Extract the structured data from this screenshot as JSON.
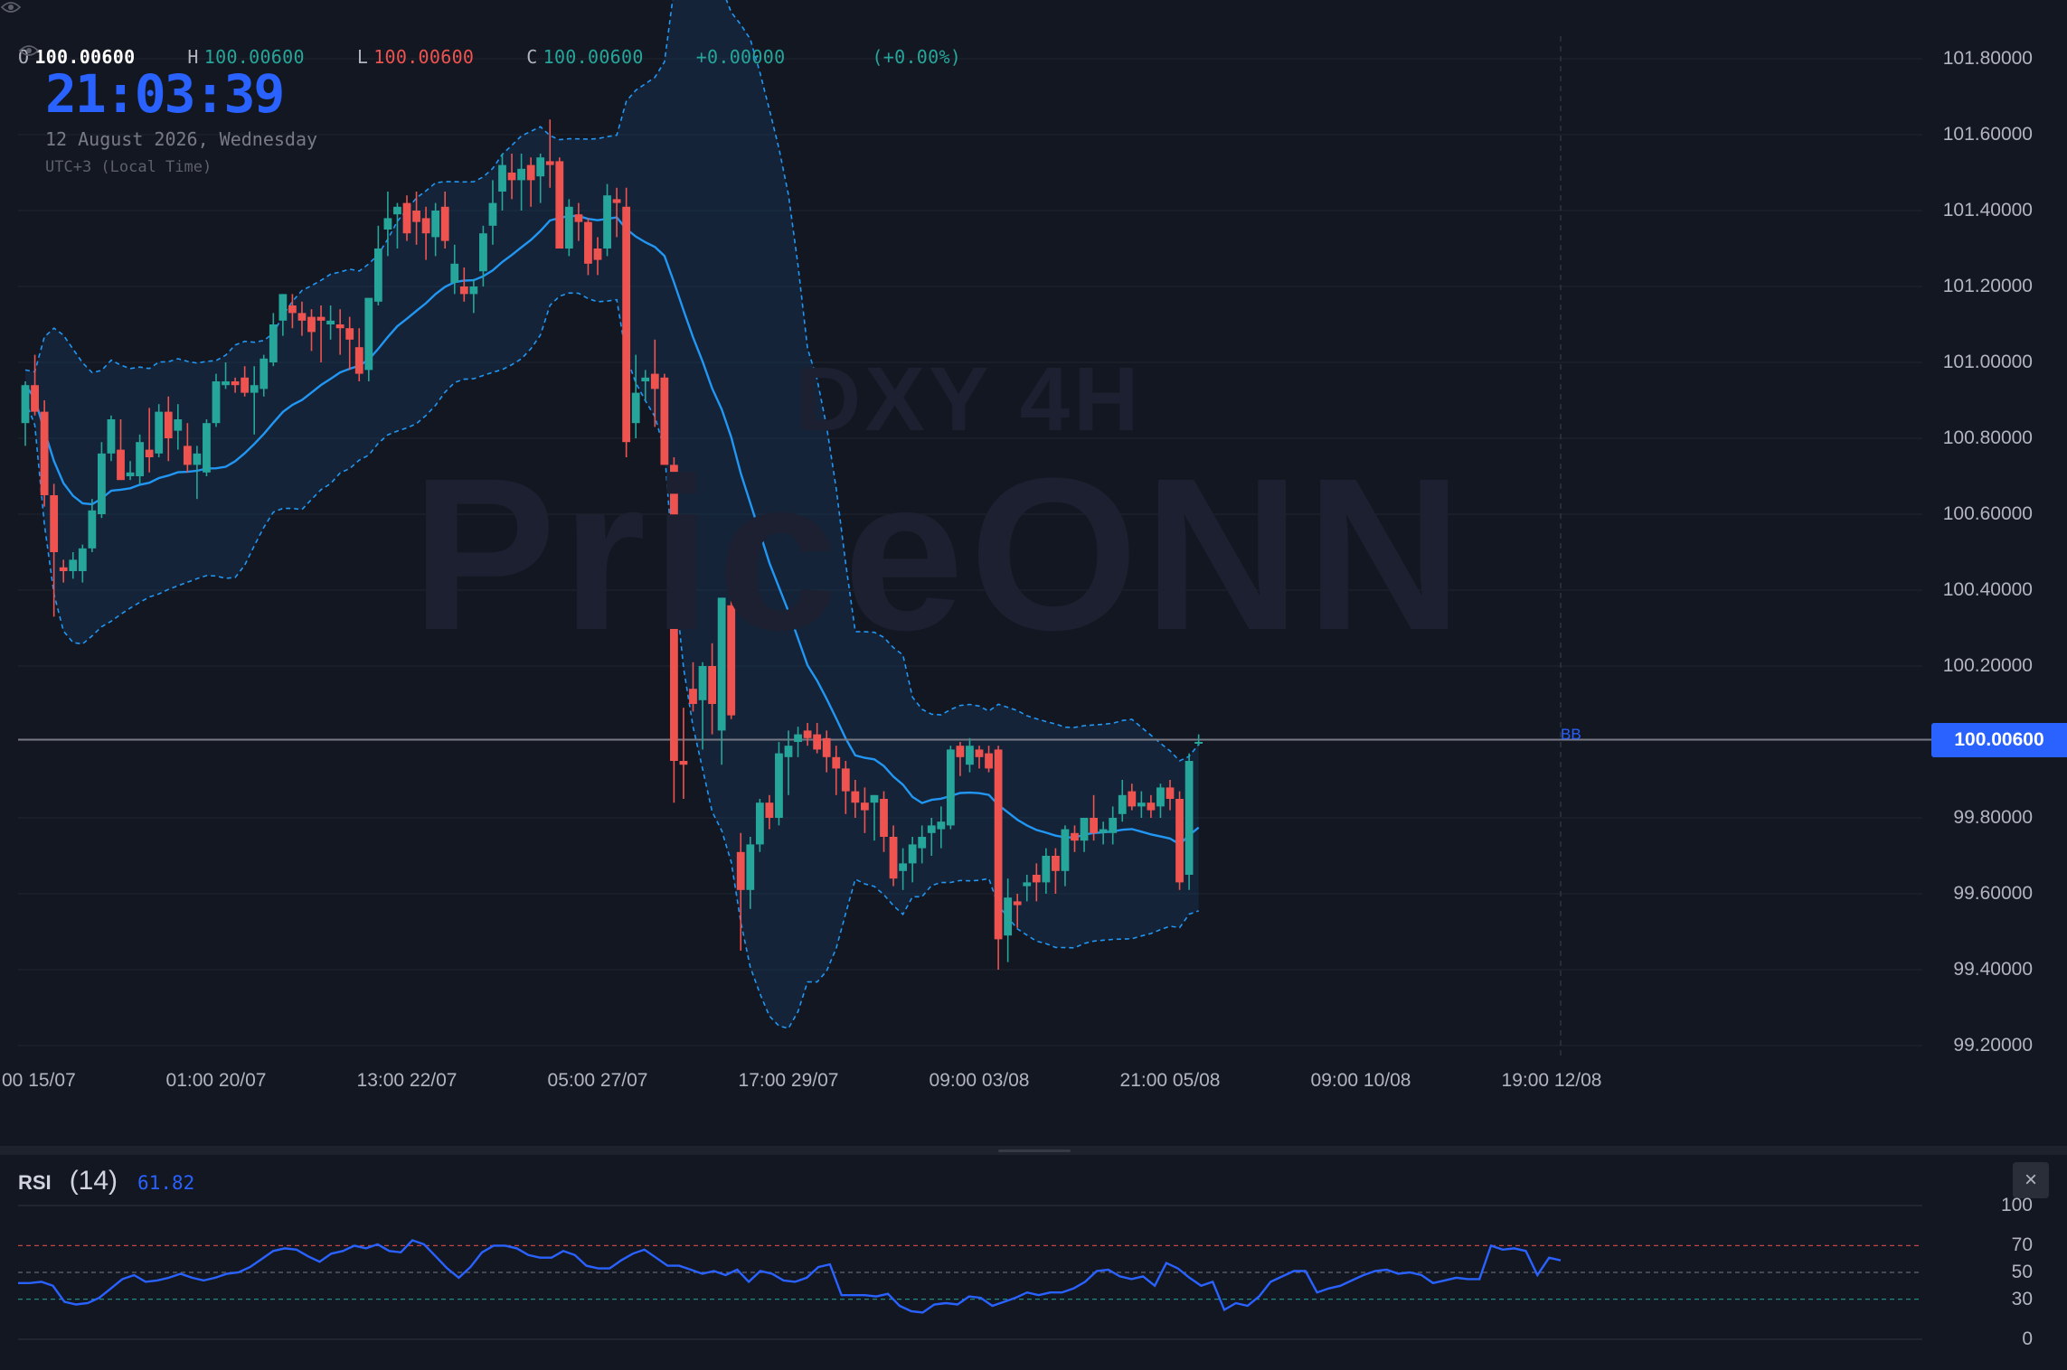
{
  "legend": {
    "o_label": "O",
    "o_value": "100.00600",
    "h_label": "H",
    "h_value": "100.00600",
    "l_label": "L",
    "l_value": "100.00600",
    "c_label": "C",
    "c_value": "100.00600",
    "change": "+0.00000",
    "change_pct": "(+0.00%)"
  },
  "clock": {
    "time": "21:03:39",
    "date": "12 August 2026, Wednesday",
    "timezone": "UTC+3 (Local Time)"
  },
  "watermark": {
    "symbol": "DXY 4H",
    "brand": "PriceONN"
  },
  "current_price": {
    "label": "100.00600",
    "value": 100.006,
    "indicator_tag": "BB"
  },
  "colors": {
    "background": "#131722",
    "up": "#26a69a",
    "down": "#ef5350",
    "accent": "#2962ff",
    "bb_basis": "#2196f3",
    "bb_band": "#2196f3"
  },
  "icons": {
    "visibility": "eye-icon",
    "close": "close-icon"
  },
  "chart_data": {
    "type": "candlestick",
    "y_axis_labels": [
      "101.80000",
      "101.60000",
      "101.40000",
      "101.20000",
      "101.00000",
      "100.80000",
      "100.60000",
      "100.40000",
      "100.20000",
      "99.80000",
      "99.60000",
      "99.40000",
      "99.20000"
    ],
    "y_axis_values": [
      101.8,
      101.6,
      101.4,
      101.2,
      101.0,
      100.8,
      100.6,
      100.4,
      100.2,
      99.8,
      99.6,
      99.4,
      99.2
    ],
    "ylim": [
      99.2,
      101.8
    ],
    "x_axis_labels": [
      "00 15/07",
      "01:00 20/07",
      "13:00 22/07",
      "05:00 27/07",
      "17:00 29/07",
      "09:00 03/08",
      "21:00 05/08",
      "09:00 10/08",
      "19:00 12/08"
    ],
    "x_axis_indices": [
      0.5,
      20,
      40,
      60,
      80,
      100,
      120,
      140,
      160
    ],
    "indicator": "Bollinger Bands",
    "candles": [
      [
        100.84,
        100.95,
        100.78,
        100.94
      ],
      [
        100.94,
        101.02,
        100.86,
        100.87
      ],
      [
        100.87,
        100.9,
        100.62,
        100.65
      ],
      [
        100.65,
        100.68,
        100.33,
        100.5
      ],
      [
        100.46,
        100.48,
        100.42,
        100.45
      ],
      [
        100.45,
        100.5,
        100.43,
        100.48
      ],
      [
        100.45,
        100.52,
        100.42,
        100.51
      ],
      [
        100.51,
        100.64,
        100.5,
        100.61
      ],
      [
        100.6,
        100.79,
        100.59,
        100.76
      ],
      [
        100.76,
        100.86,
        100.74,
        100.85
      ],
      [
        100.77,
        100.85,
        100.72,
        100.69
      ],
      [
        100.7,
        100.74,
        100.69,
        100.71
      ],
      [
        100.7,
        100.81,
        100.68,
        100.79
      ],
      [
        100.77,
        100.88,
        100.71,
        100.75
      ],
      [
        100.76,
        100.89,
        100.75,
        100.87
      ],
      [
        100.87,
        100.91,
        100.74,
        100.8
      ],
      [
        100.82,
        100.89,
        100.77,
        100.85
      ],
      [
        100.78,
        100.84,
        100.71,
        100.73
      ],
      [
        100.73,
        100.78,
        100.64,
        100.76
      ],
      [
        100.71,
        100.85,
        100.7,
        100.84
      ],
      [
        100.84,
        100.97,
        100.83,
        100.95
      ],
      [
        100.94,
        101.0,
        100.93,
        100.95
      ],
      [
        100.95,
        100.96,
        100.92,
        100.94
      ],
      [
        100.96,
        100.99,
        100.91,
        100.92
      ],
      [
        100.92,
        100.99,
        100.81,
        100.94
      ],
      [
        100.93,
        101.02,
        100.91,
        101.01
      ],
      [
        101.0,
        101.13,
        100.99,
        101.1
      ],
      [
        101.11,
        101.18,
        101.07,
        101.18
      ],
      [
        101.15,
        101.18,
        101.09,
        101.13
      ],
      [
        101.13,
        101.16,
        101.07,
        101.11
      ],
      [
        101.12,
        101.14,
        101.03,
        101.08
      ],
      [
        101.12,
        101.15,
        101.0,
        101.11
      ],
      [
        101.1,
        101.15,
        101.06,
        101.11
      ],
      [
        101.1,
        101.14,
        101.02,
        101.09
      ],
      [
        101.09,
        101.12,
        100.98,
        101.06
      ],
      [
        101.04,
        101.09,
        100.95,
        100.97
      ],
      [
        100.98,
        101.14,
        100.95,
        101.17
      ],
      [
        101.16,
        101.36,
        101.15,
        101.3
      ],
      [
        101.35,
        101.45,
        101.28,
        101.38
      ],
      [
        101.39,
        101.42,
        101.3,
        101.41
      ],
      [
        101.42,
        101.44,
        101.32,
        101.34
      ],
      [
        101.4,
        101.45,
        101.31,
        101.37
      ],
      [
        101.38,
        101.41,
        101.27,
        101.34
      ],
      [
        101.33,
        101.42,
        101.28,
        101.4
      ],
      [
        101.41,
        101.45,
        101.3,
        101.32
      ],
      [
        101.21,
        101.31,
        101.18,
        101.26
      ],
      [
        101.2,
        101.25,
        101.16,
        101.18
      ],
      [
        101.18,
        101.22,
        101.13,
        101.2
      ],
      [
        101.24,
        101.36,
        101.2,
        101.34
      ],
      [
        101.36,
        101.48,
        101.31,
        101.42
      ],
      [
        101.45,
        101.55,
        101.4,
        101.52
      ],
      [
        101.5,
        101.55,
        101.43,
        101.48
      ],
      [
        101.48,
        101.55,
        101.4,
        101.51
      ],
      [
        101.52,
        101.54,
        101.41,
        101.48
      ],
      [
        101.49,
        101.55,
        101.42,
        101.54
      ],
      [
        101.53,
        101.64,
        101.46,
        101.52
      ],
      [
        101.53,
        101.54,
        101.3,
        101.3
      ],
      [
        101.3,
        101.43,
        101.28,
        101.41
      ],
      [
        101.39,
        101.42,
        101.32,
        101.37
      ],
      [
        101.37,
        101.38,
        101.23,
        101.26
      ],
      [
        101.3,
        101.33,
        101.23,
        101.27
      ],
      [
        101.3,
        101.47,
        101.28,
        101.44
      ],
      [
        101.43,
        101.46,
        101.33,
        101.42
      ],
      [
        101.41,
        101.46,
        100.75,
        100.79
      ],
      [
        100.84,
        101.02,
        100.8,
        100.92
      ],
      [
        100.95,
        100.98,
        100.9,
        100.96
      ],
      [
        100.97,
        101.06,
        100.83,
        100.93
      ],
      [
        100.96,
        100.97,
        100.73,
        100.73
      ],
      [
        100.73,
        100.75,
        99.84,
        99.95
      ],
      [
        99.95,
        100.09,
        99.85,
        99.94
      ],
      [
        100.14,
        100.21,
        100.08,
        100.1
      ],
      [
        100.11,
        100.21,
        99.98,
        100.2
      ],
      [
        100.2,
        100.26,
        100.02,
        100.1
      ],
      [
        100.03,
        100.37,
        99.94,
        100.38
      ],
      [
        100.36,
        100.43,
        100.06,
        100.07
      ],
      [
        99.71,
        99.76,
        99.45,
        99.61
      ],
      [
        99.61,
        99.75,
        99.56,
        99.73
      ],
      [
        99.73,
        99.85,
        99.71,
        99.84
      ],
      [
        99.84,
        99.86,
        99.77,
        99.8
      ],
      [
        99.8,
        100.0,
        99.78,
        99.97
      ],
      [
        99.96,
        100.03,
        99.86,
        99.99
      ],
      [
        100.0,
        100.04,
        99.96,
        100.02
      ],
      [
        100.03,
        100.05,
        99.99,
        100.01
      ],
      [
        100.02,
        100.05,
        99.97,
        99.98
      ],
      [
        100.01,
        100.03,
        99.92,
        99.96
      ],
      [
        99.96,
        99.99,
        99.86,
        99.93
      ],
      [
        99.93,
        99.95,
        99.81,
        99.87
      ],
      [
        99.87,
        99.9,
        99.8,
        99.84
      ],
      [
        99.84,
        99.88,
        99.76,
        99.82
      ],
      [
        99.84,
        99.86,
        99.74,
        99.86
      ],
      [
        99.85,
        99.87,
        99.71,
        99.75
      ],
      [
        99.75,
        99.78,
        99.62,
        99.64
      ],
      [
        99.66,
        99.72,
        99.61,
        99.68
      ],
      [
        99.68,
        99.75,
        99.63,
        99.73
      ],
      [
        99.72,
        99.78,
        99.68,
        99.75
      ],
      [
        99.76,
        99.8,
        99.7,
        99.78
      ],
      [
        99.77,
        99.83,
        99.72,
        99.79
      ],
      [
        99.78,
        99.99,
        99.77,
        99.98
      ],
      [
        99.99,
        100.0,
        99.91,
        99.96
      ],
      [
        99.94,
        100.01,
        99.92,
        99.99
      ],
      [
        99.98,
        99.99,
        99.93,
        99.96
      ],
      [
        99.97,
        99.99,
        99.92,
        99.93
      ],
      [
        99.98,
        99.99,
        99.4,
        99.48
      ],
      [
        99.49,
        99.64,
        99.42,
        99.59
      ],
      [
        99.58,
        99.6,
        99.51,
        99.57
      ],
      [
        99.62,
        99.65,
        99.58,
        99.63
      ],
      [
        99.65,
        99.68,
        99.58,
        99.63
      ],
      [
        99.63,
        99.72,
        99.6,
        99.7
      ],
      [
        99.7,
        99.72,
        99.6,
        99.66
      ],
      [
        99.66,
        99.78,
        99.62,
        99.77
      ],
      [
        99.76,
        99.78,
        99.71,
        99.74
      ],
      [
        99.74,
        99.79,
        99.71,
        99.8
      ],
      [
        99.8,
        99.86,
        99.74,
        99.76
      ],
      [
        99.76,
        99.79,
        99.73,
        99.77
      ],
      [
        99.76,
        99.83,
        99.73,
        99.8
      ],
      [
        99.81,
        99.9,
        99.79,
        99.86
      ],
      [
        99.87,
        99.89,
        99.82,
        99.83
      ],
      [
        99.83,
        99.87,
        99.8,
        99.84
      ],
      [
        99.84,
        99.86,
        99.8,
        99.82
      ],
      [
        99.83,
        99.89,
        99.8,
        99.88
      ],
      [
        99.88,
        99.9,
        99.82,
        99.85
      ],
      [
        99.85,
        99.87,
        99.61,
        99.63
      ],
      [
        99.65,
        99.97,
        99.61,
        99.95
      ],
      [
        100.0,
        100.02,
        99.99,
        100.0
      ]
    ]
  },
  "rsi": {
    "name": "RSI",
    "length": "(14)",
    "value": "61.82",
    "axis_labels": [
      "100",
      "70",
      "50",
      "30",
      "0"
    ],
    "axis_values": [
      100,
      70,
      50,
      30,
      0
    ],
    "levels": [
      70,
      50,
      30
    ],
    "chart_data": {
      "type": "line",
      "ylim": [
        0,
        100
      ],
      "values": [
        42,
        42,
        43,
        40,
        28,
        26,
        27,
        31,
        38,
        45,
        48,
        43,
        44,
        46,
        49,
        46,
        44,
        46,
        49,
        50,
        54,
        60,
        66,
        68,
        67,
        62,
        58,
        64,
        66,
        70,
        68,
        71,
        66,
        65,
        74,
        71,
        62,
        53,
        46,
        54,
        65,
        70,
        70,
        68,
        63,
        61,
        61,
        66,
        63,
        55,
        53,
        53,
        59,
        64,
        67,
        61,
        55,
        55,
        52,
        49,
        51,
        48,
        52,
        43,
        51,
        49,
        44,
        43,
        46,
        54,
        56,
        33,
        33,
        33,
        32,
        34,
        25,
        21,
        20,
        26,
        27,
        26,
        32,
        31,
        25,
        28,
        31,
        35,
        33,
        35,
        35,
        38,
        43,
        51,
        52,
        47,
        45,
        47,
        40,
        57,
        53,
        46,
        40,
        43,
        22,
        27,
        25,
        32,
        43,
        47,
        51,
        51,
        35,
        38,
        40,
        44,
        48,
        51,
        52,
        49,
        50,
        48,
        42,
        44,
        46,
        45,
        45,
        70,
        67,
        68,
        66,
        48,
        61,
        59
      ]
    }
  }
}
